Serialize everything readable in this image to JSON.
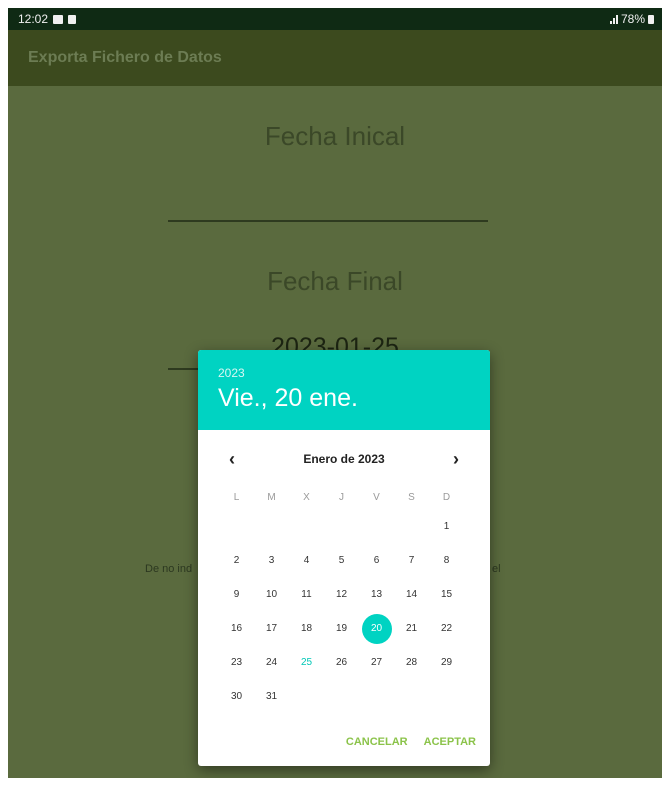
{
  "status_bar": {
    "time": "12:02",
    "battery": "78%"
  },
  "app_bar": {
    "title": "Exporta Fichero de Datos"
  },
  "form": {
    "start_label": "Fecha Inical",
    "start_value": "",
    "end_label": "Fecha Final",
    "end_value": "2023-01-25",
    "hint_left": "De no ind",
    "hint_right": "el"
  },
  "dialog": {
    "year": "2023",
    "selected_date": "Vie., 20 ene.",
    "month_title": "Enero de 2023",
    "prev_icon": "‹",
    "next_icon": "›",
    "weekdays": [
      "L",
      "M",
      "X",
      "J",
      "V",
      "S",
      "D"
    ],
    "weeks": [
      [
        "",
        "",
        "",
        "",
        "",
        "",
        "1"
      ],
      [
        "2",
        "3",
        "4",
        "5",
        "6",
        "7",
        "8"
      ],
      [
        "9",
        "10",
        "11",
        "12",
        "13",
        "14",
        "15"
      ],
      [
        "16",
        "17",
        "18",
        "19",
        "20",
        "21",
        "22"
      ],
      [
        "23",
        "24",
        "25",
        "26",
        "27",
        "28",
        "29"
      ],
      [
        "30",
        "31",
        "",
        "",
        "",
        "",
        ""
      ]
    ],
    "selected_day": "20",
    "today_day": "25",
    "cancel_label": "CANCELAR",
    "ok_label": "ACEPTAR",
    "accent_color": "#00d3c2",
    "button_color": "#8bc34a"
  }
}
